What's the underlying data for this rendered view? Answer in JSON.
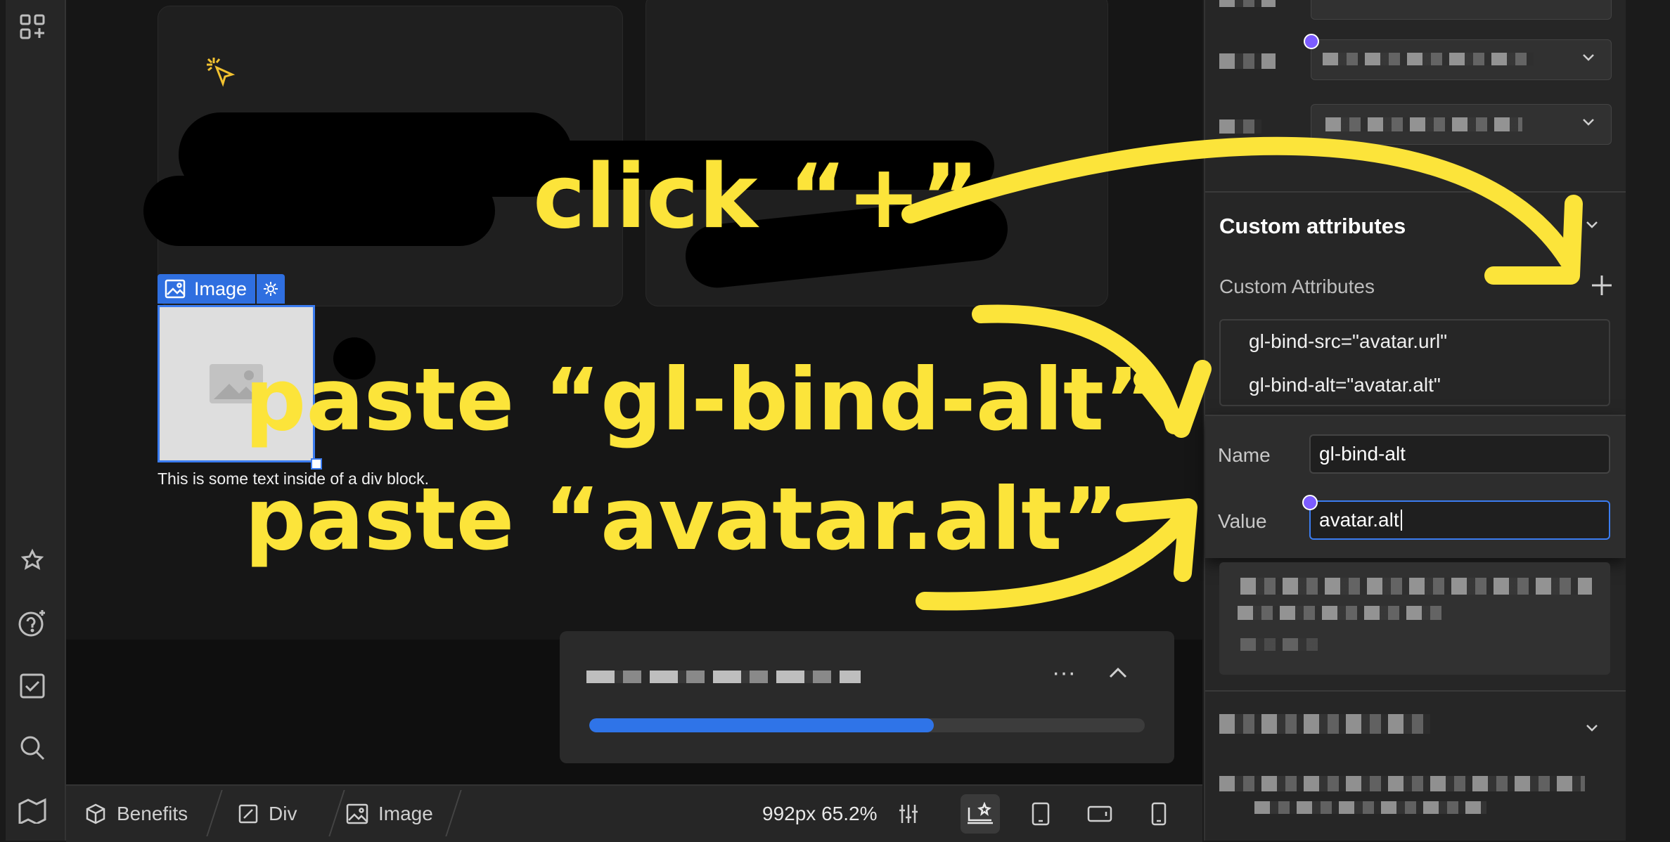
{
  "canvas": {
    "element_tag": "Image",
    "div_text": "This is some text inside of a div block."
  },
  "toast": {
    "progress": 0.62
  },
  "breadcrumb": [
    "Benefits",
    "Div",
    "Image"
  ],
  "viewport": {
    "label": "992px 65.2%"
  },
  "panel": {
    "section_title": "Custom attributes",
    "sub_label": "Custom Attributes",
    "attributes": [
      "gl-bind-src=\"avatar.url\"",
      "gl-bind-alt=\"avatar.alt\""
    ],
    "popover": {
      "name_label": "Name",
      "name_value": "gl-bind-alt",
      "value_label": "Value",
      "value_value": "avatar.alt"
    }
  },
  "annotations": {
    "step1": "click “+”",
    "step2": "paste “gl-bind-alt”",
    "step3": "paste “avatar.alt”"
  },
  "colors": {
    "accent": "#2f74e8",
    "annotation": "#fce43a",
    "focus_dot": "#7c5cff"
  }
}
